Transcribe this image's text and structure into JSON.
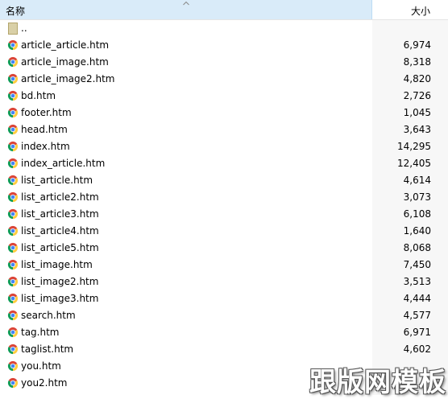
{
  "header": {
    "name_label": "名称",
    "size_label": "大小",
    "sort_direction": "ascending"
  },
  "parent_row": {
    "name": ".."
  },
  "files": [
    {
      "name": "article_article.htm",
      "size": "6,974"
    },
    {
      "name": "article_image.htm",
      "size": "8,318"
    },
    {
      "name": "article_image2.htm",
      "size": "4,820"
    },
    {
      "name": "bd.htm",
      "size": "2,726"
    },
    {
      "name": "footer.htm",
      "size": "1,045"
    },
    {
      "name": "head.htm",
      "size": "3,643"
    },
    {
      "name": "index.htm",
      "size": "14,295"
    },
    {
      "name": "index_article.htm",
      "size": "12,405"
    },
    {
      "name": "list_article.htm",
      "size": "4,614"
    },
    {
      "name": "list_article2.htm",
      "size": "3,073"
    },
    {
      "name": "list_article3.htm",
      "size": "6,108"
    },
    {
      "name": "list_article4.htm",
      "size": "1,640"
    },
    {
      "name": "list_article5.htm",
      "size": "8,068"
    },
    {
      "name": "list_image.htm",
      "size": "7,450"
    },
    {
      "name": "list_image2.htm",
      "size": "3,513"
    },
    {
      "name": "list_image3.htm",
      "size": "4,444"
    },
    {
      "name": "search.htm",
      "size": "4,577"
    },
    {
      "name": "tag.htm",
      "size": "6,971"
    },
    {
      "name": "taglist.htm",
      "size": "4,602"
    },
    {
      "name": "you.htm",
      "size": ""
    },
    {
      "name": "you2.htm",
      "size": ""
    }
  ],
  "file_icon": "chrome-icon",
  "watermark": "跟版网模板",
  "colors": {
    "header_selected": "#d9ebf9",
    "size_column_bg": "#f7f7f7"
  }
}
